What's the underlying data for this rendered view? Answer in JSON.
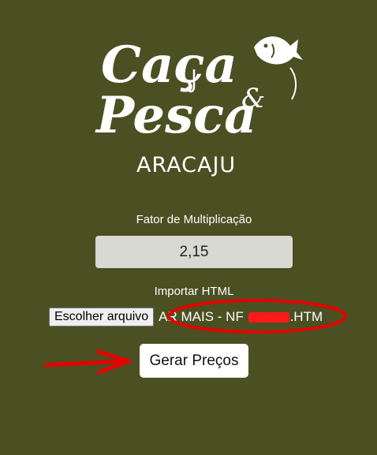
{
  "logo": {
    "line1": "Caça",
    "ampersand": "&",
    "line2": "Pesca",
    "city": "ARACAJU"
  },
  "form": {
    "factor_label": "Fator de Multiplicação",
    "factor_value": "2,15",
    "import_label": "Importar HTML",
    "file_button_label": "Escolher arquivo",
    "file_name_prefix": "AR MAIS - NF ",
    "file_name_suffix": ".HTM",
    "submit_label": "Gerar Preços"
  },
  "colors": {
    "background": "#4b5023",
    "input_bg": "#d9d9d3",
    "annotation": "#e60000"
  }
}
